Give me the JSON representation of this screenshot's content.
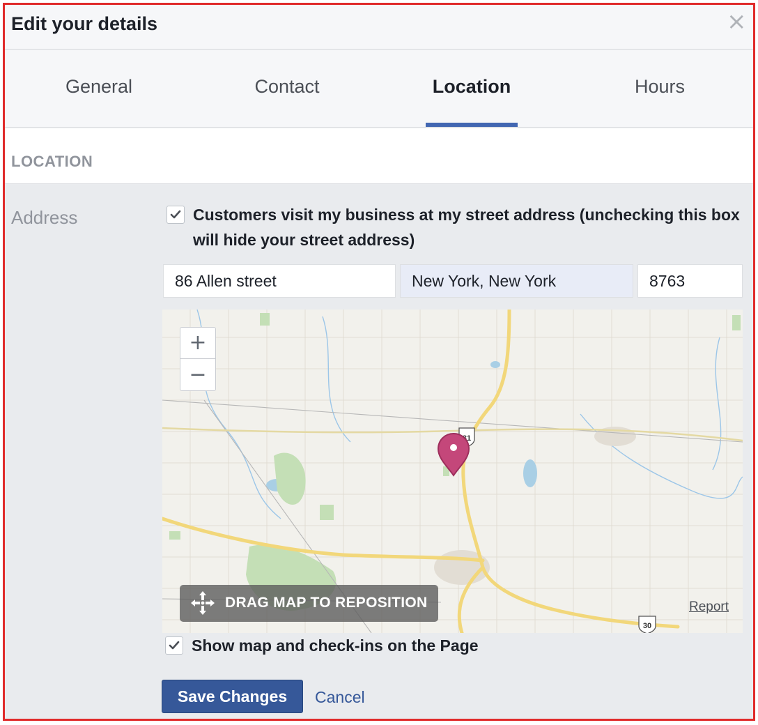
{
  "dialog": {
    "title": "Edit your details",
    "close_icon": "close-icon"
  },
  "tabs": [
    {
      "label": "General",
      "active": false
    },
    {
      "label": "Contact",
      "active": false
    },
    {
      "label": "Location",
      "active": true
    },
    {
      "label": "Hours",
      "active": false
    }
  ],
  "section": {
    "title": "LOCATION"
  },
  "address": {
    "label": "Address",
    "visit_checkbox": {
      "checked": true,
      "label": "Customers visit my business at my street address (unchecking this box will hide your street address)"
    },
    "street_value": "86 Allen street",
    "city_value": "New York, New York",
    "zip_value": "8763"
  },
  "map": {
    "zoom_in_label": "+",
    "zoom_out_label": "−",
    "drag_hint": "DRAG MAP TO REPOSITION",
    "report_label": "Report",
    "road_shields": [
      "31",
      "30"
    ],
    "pin_color": "#c4477a"
  },
  "show_map_checkbox": {
    "checked": true,
    "label": "Show map and check-ins on the Page"
  },
  "actions": {
    "save_label": "Save Changes",
    "cancel_label": "Cancel"
  },
  "colors": {
    "accent": "#4267b2",
    "button": "#365899",
    "frame_border": "#e02b2b"
  }
}
